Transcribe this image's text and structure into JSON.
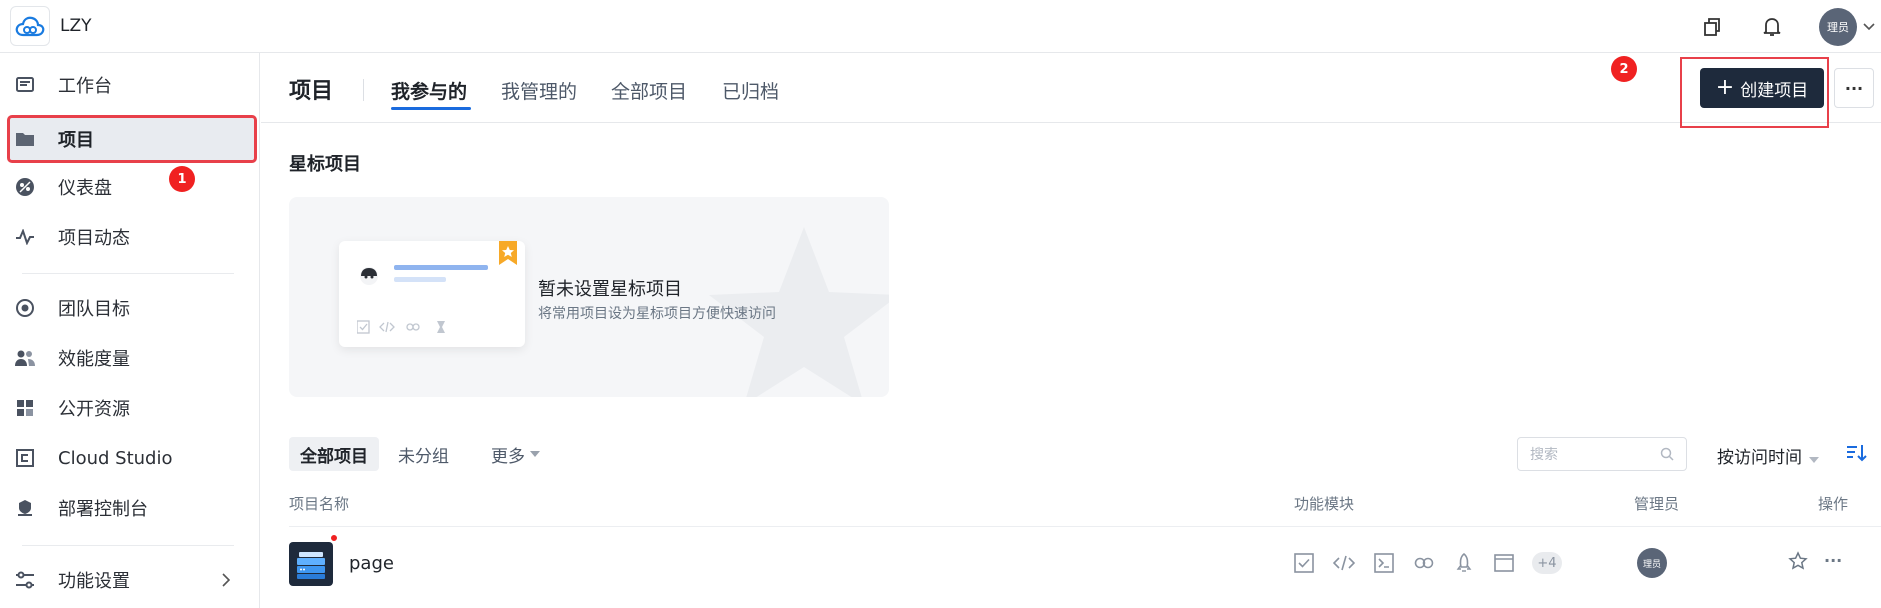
{
  "topbar": {
    "org_name": "LZY",
    "user_avatar_text": "理员"
  },
  "sidebar": {
    "items": [
      {
        "label": "工作台",
        "icon": "workbench-icon"
      },
      {
        "label": "项目",
        "icon": "folder-icon",
        "active": true
      },
      {
        "label": "仪表盘",
        "icon": "dashboard-icon"
      },
      {
        "label": "项目动态",
        "icon": "activity-icon"
      },
      {
        "label": "团队目标",
        "icon": "target-icon"
      },
      {
        "label": "效能度量",
        "icon": "people-icon"
      },
      {
        "label": "公开资源",
        "icon": "grid-icon"
      },
      {
        "label": "Cloud Studio",
        "icon": "cloud-studio-icon"
      },
      {
        "label": "部署控制台",
        "icon": "deploy-icon"
      },
      {
        "label": "功能设置",
        "icon": "settings-sliders-icon"
      }
    ]
  },
  "annotations": {
    "badge1": "1",
    "badge2": "2"
  },
  "header": {
    "title": "项目",
    "tabs": [
      "我参与的",
      "我管理的",
      "全部项目",
      "已归档"
    ],
    "active_tab": "我参与的",
    "create_button": "创建项目",
    "more": "···"
  },
  "starred": {
    "title": "星标项目",
    "empty_title": "暂未设置星标项目",
    "empty_subtitle": "将常用项目设为星标项目方便快速访问"
  },
  "filters": {
    "tabs": [
      "全部项目",
      "未分组",
      "更多"
    ],
    "search_placeholder": "搜索",
    "sort_label": "按访问时间"
  },
  "table": {
    "columns": [
      "项目名称",
      "功能模块",
      "管理员",
      "操作"
    ],
    "rows": [
      {
        "name": "page",
        "modules": [
          "task-icon",
          "code-icon",
          "terminal-icon",
          "link-icon",
          "rocket-icon",
          "window-icon"
        ],
        "modules_more": "+4",
        "manager": "理员"
      }
    ]
  },
  "colors": {
    "accent": "#1a6bde",
    "primary_button": "#1e2a3c",
    "annotation_red": "#e8404a",
    "badge_red": "#f02121"
  }
}
